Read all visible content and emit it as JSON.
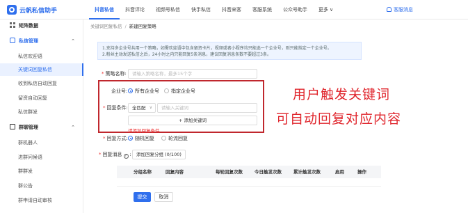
{
  "app": {
    "name": "云帆私信助手"
  },
  "top_tabs": [
    {
      "label": "抖音私信",
      "active": true
    },
    {
      "label": "抖音评论"
    },
    {
      "label": "视频号私信"
    },
    {
      "label": "快手私信"
    },
    {
      "label": "抖音来客"
    },
    {
      "label": "客服系统"
    },
    {
      "label": "公众号助手"
    },
    {
      "label": "更多"
    }
  ],
  "header": {
    "service_msg": "客服消息"
  },
  "sidebar": {
    "items": [
      {
        "label": "矩阵数据",
        "type": "group",
        "icon": "grid-icon"
      },
      {
        "label": "私信管理",
        "type": "group",
        "icon": "chat-icon",
        "expanded": true
      },
      {
        "label": "私信欢迎语"
      },
      {
        "label": "关键词回复私信",
        "active": true
      },
      {
        "label": "收到私信自动回复"
      },
      {
        "label": "留资自动回复"
      },
      {
        "label": "私信群发"
      },
      {
        "label": "群聊管理",
        "type": "group",
        "icon": "group-icon",
        "expanded": true
      },
      {
        "label": "群机器人"
      },
      {
        "label": "进群问候语"
      },
      {
        "label": "群群发"
      },
      {
        "label": "群公告"
      },
      {
        "label": "群申请自动审核"
      }
    ]
  },
  "breadcrumb": {
    "parent": "关键词回复私信",
    "current": "新建回复策略"
  },
  "notice": {
    "line1": "1.支持多企业号共用一个策略，如需欢迎语中包含留资卡片，视频或者小程序均只能选一个企业号，则只能指定一个企业号。",
    "line2": "2.粉丝主动发送私信之后，24小时之内只能回复5条消息，建议回复消息条数不要超过3条。"
  },
  "form": {
    "strategy_name": {
      "label": "策略名称:",
      "placeholder": "请输入策略名称，最多15个字"
    },
    "enterprise": {
      "label": "企业号:",
      "option_all": "所有企业号",
      "option_specific": "指定企业号"
    },
    "condition": {
      "label": "回复条件:",
      "match_mode": "全匹配",
      "keyword_placeholder": "请输入关键词",
      "add_keyword": "添加关键词"
    },
    "error": "请添加回复条件",
    "reply_mode": {
      "label": "回复方式:",
      "option_random": "随机回复",
      "option_rotate": "轮流回复"
    },
    "reply_message": {
      "label": "回复消息",
      "add_group": "添加回复分组 (0/100)"
    }
  },
  "annotation": {
    "line1": "用户触发关键词",
    "line2": "可自动回复对应内容"
  },
  "table": {
    "headers": [
      "分组名称",
      "回复内容",
      "每轮回复次数",
      "今日触发次数",
      "累计触发次数",
      "启用",
      "操作"
    ]
  },
  "buttons": {
    "submit": "提交",
    "cancel": "取消"
  },
  "colors": {
    "primary": "#2f6fed",
    "annotation": "#e0262d",
    "highlight_border": "#c0272d"
  }
}
